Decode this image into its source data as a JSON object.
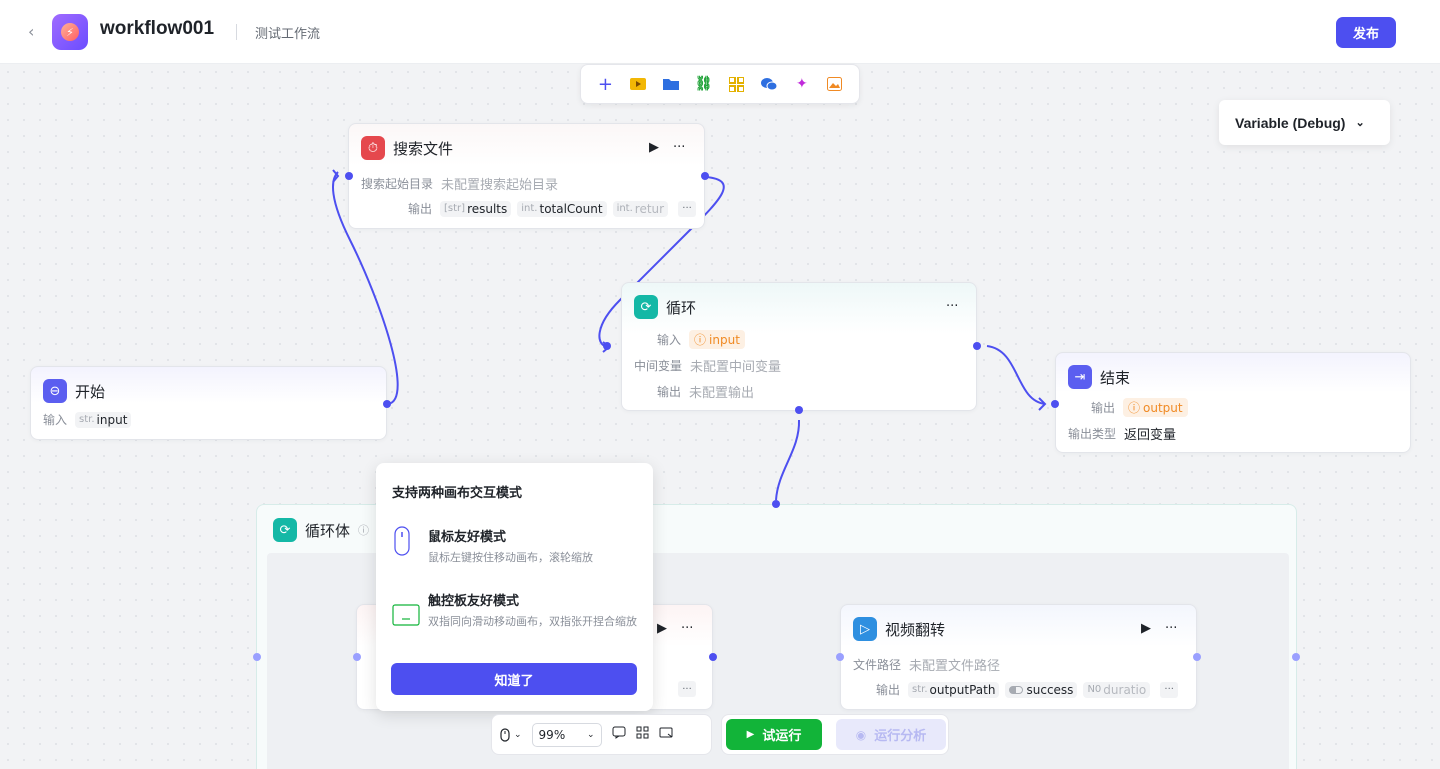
{
  "header": {
    "title": "workflow001",
    "description": "测试工作流",
    "publish_label": "发布"
  },
  "toolbar": {
    "icons": [
      "plus-icon",
      "video-icon",
      "folder-icon",
      "link-icon",
      "grid-icon",
      "wechat-icon",
      "sparkle-icon",
      "image-icon"
    ]
  },
  "variable_debug": {
    "label": "Variable (Debug)"
  },
  "nodes": {
    "search": {
      "title": "搜索文件",
      "dir_label": "搜索起始目录",
      "dir_value": "未配置搜索起始目录",
      "output_label": "输出",
      "outputs": [
        {
          "type": "[str]",
          "name": "results"
        },
        {
          "type": "int.",
          "name": "totalCount"
        },
        {
          "type": "int.",
          "name": "retur"
        }
      ]
    },
    "loop": {
      "title": "循环",
      "input_label": "输入",
      "input_value": "input",
      "mid_label": "中间变量",
      "mid_value": "未配置中间变量",
      "output_label": "输出",
      "output_value": "未配置输出"
    },
    "start": {
      "title": "开始",
      "input_label": "输入",
      "input_type": "str.",
      "input_name": "input"
    },
    "end": {
      "title": "结束",
      "output_label": "输出",
      "output_value": "output",
      "type_label": "输出类型",
      "type_value": "返回变量"
    },
    "loop_body": {
      "title": "循环体"
    },
    "video_flip": {
      "title": "视频翻转",
      "path_label": "文件路径",
      "path_value": "未配置文件路径",
      "output_label": "输出",
      "outputs": [
        {
          "type": "str.",
          "name": "outputPath"
        },
        {
          "type": "toggle",
          "name": "success"
        },
        {
          "type": "N0",
          "name": "duratio"
        }
      ]
    }
  },
  "popup": {
    "title": "支持两种画布交互模式",
    "mouse_title": "鼠标友好模式",
    "mouse_desc": "鼠标左键按住移动画布，滚轮缩放",
    "touchpad_title": "触控板友好模式",
    "touchpad_desc": "双指同向滑动移动画布，双指张开捏合缩放",
    "button_label": "知道了"
  },
  "bottom": {
    "zoom": "99%",
    "run_label": "试运行",
    "analyze_label": "运行分析"
  },
  "colors": {
    "accent": "#4d4ff0",
    "run_green": "#12b439",
    "loop_teal": "#14b8a6",
    "search_red": "#e5484d",
    "warn_orange": "#f08a24"
  }
}
